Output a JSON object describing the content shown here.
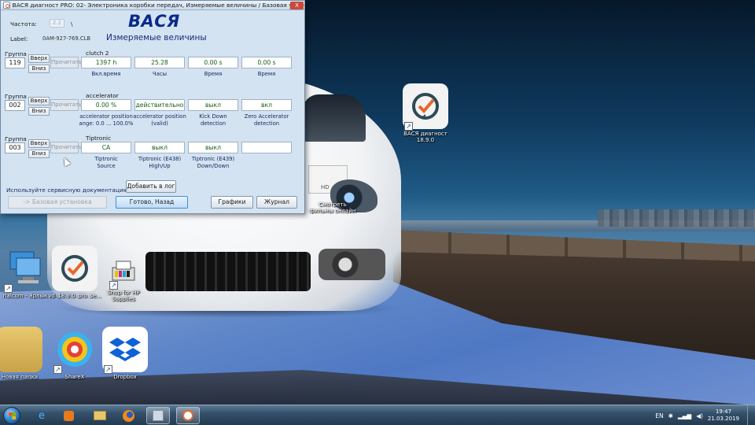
{
  "window": {
    "title": "ВАСЯ диагност PRO: 02- Электроника коробки передач,  Измеряемые величины / Базовая установка",
    "close_label": "X",
    "frequency_label": "Частота:",
    "frequency_value": "2.2",
    "frequency_unit": "\\",
    "app_title": "ВАСЯ",
    "label_caption": "Label:",
    "label_value": "0AM-927-769.CLB",
    "subtitle": "Измеряемые величины"
  },
  "groups": [
    {
      "label": "Группа",
      "number": "119",
      "up": "Вверх",
      "down": "Вниз",
      "read": "Прочитать",
      "name": "clutch 2",
      "cells": [
        {
          "value": "1397 h",
          "caption": "Вкл.время"
        },
        {
          "value": "25.28",
          "caption": "Часы"
        },
        {
          "value": "0.00 s",
          "caption": "Время"
        },
        {
          "value": "0.00 s",
          "caption": "Время"
        }
      ]
    },
    {
      "label": "Группа",
      "number": "002",
      "up": "Вверх",
      "down": "Вниз",
      "read": "Прочитать",
      "name": "accelerator",
      "cells": [
        {
          "value": "0.00 %",
          "caption": "accelerator position",
          "caption2": "ange: 0.0 ... 100.0%"
        },
        {
          "value": "действительно",
          "caption": "accelerator position",
          "caption2": "(valid)"
        },
        {
          "value": "выкл",
          "caption": "Kick Down",
          "caption2": "detection"
        },
        {
          "value": "вкл",
          "caption": "Zero Accelerator",
          "caption2": "detection"
        }
      ]
    },
    {
      "label": "Группа",
      "number": "003",
      "up": "Вверх",
      "down": "Вниз",
      "read": "Прочитать",
      "name": "Tiptronic",
      "cells": [
        {
          "value": "CA",
          "caption": "Tiptronic",
          "caption2": "Source"
        },
        {
          "value": "выкл",
          "caption": "Tiptronic (E438)",
          "caption2": "High/Up"
        },
        {
          "value": "выкл",
          "caption": "Tiptronic (E439)",
          "caption2": "Down/Down"
        },
        {
          "value": "",
          "caption": "",
          "caption2": ""
        }
      ]
    }
  ],
  "footer": {
    "doc_note": "Используйте сервисную документацию!",
    "add_log": "Добавить в лог",
    "basic_setting": "-> Базовая установка",
    "done_back": "Готово, Назад",
    "graphs": "Графики",
    "journal": "Журнал"
  },
  "desktop_icons": [
    {
      "label": "ВАСЯ диагност",
      "label2": "18.9.0",
      "icon": "vasya-icon"
    },
    {
      "label": "Смотреть",
      "label2": "фильмы онлайн",
      "icon": "video-icon"
    },
    {
      "label": "rialcom - Ярлык",
      "icon": "remote-desktop-icon"
    },
    {
      "label": "vd_18.9.0_pro_se...",
      "icon": "vasya-icon"
    },
    {
      "label": "Shop for HP",
      "label2": "Supplies",
      "icon": "printer-icon"
    },
    {
      "label": "Новая папка",
      "icon": "folder-icon"
    },
    {
      "label": "ShareX",
      "icon": "sharex-icon"
    },
    {
      "label": "Dropbox",
      "icon": "dropbox-icon"
    }
  ],
  "wallpaper": {
    "plate_text": "HD"
  },
  "taskbar": {
    "items": [
      "ie-icon",
      "media-player-icon",
      "file-explorer-icon",
      "firefox-icon",
      "vasya-app-icon",
      "vasya-taskbar-icon"
    ],
    "language": "EN",
    "time": "19:47",
    "date": "21.03.2019"
  },
  "colors": {
    "accent": "#0a2a8c",
    "value_text": "#135f13",
    "window_bg": "#d3e3f1"
  }
}
